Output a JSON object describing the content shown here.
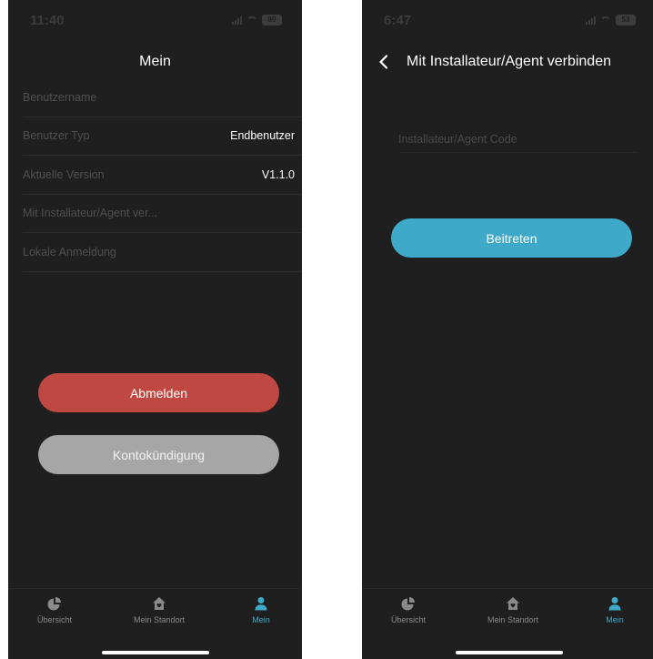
{
  "left_screen": {
    "status": {
      "time": "11:40",
      "battery": "80"
    },
    "title": "Mein",
    "menu": [
      {
        "label": "Benutzername",
        "value": ""
      },
      {
        "label": "Benutzer Typ",
        "value": "Endbenutzer"
      },
      {
        "label": "Aktuelle Version",
        "value": "V1.1.0"
      },
      {
        "label": "Mit Installateur/Agent ver...",
        "value": ""
      },
      {
        "label": "Lokale Anmeldung",
        "value": ""
      }
    ],
    "logout_label": "Abmelden",
    "delete_account_label": "Kontokündigung"
  },
  "right_screen": {
    "status": {
      "time": "6:47",
      "battery": "53"
    },
    "title": "Mit Installateur/Agent verbinden",
    "code_input": {
      "placeholder": "Installateur/Agent Code",
      "value": ""
    },
    "join_label": "Beitreten"
  },
  "tab_bar": {
    "tabs": [
      {
        "label": "Übersicht",
        "icon": "pie-chart-icon"
      },
      {
        "label": "Mein Standort",
        "icon": "home-icon"
      },
      {
        "label": "Mein",
        "icon": "person-icon"
      }
    ],
    "active_index": 2
  },
  "colors": {
    "background": "#1f1f1f",
    "accent": "#3ea9c8",
    "logout": "#c04842",
    "delete_account": "#a6a6a6"
  }
}
